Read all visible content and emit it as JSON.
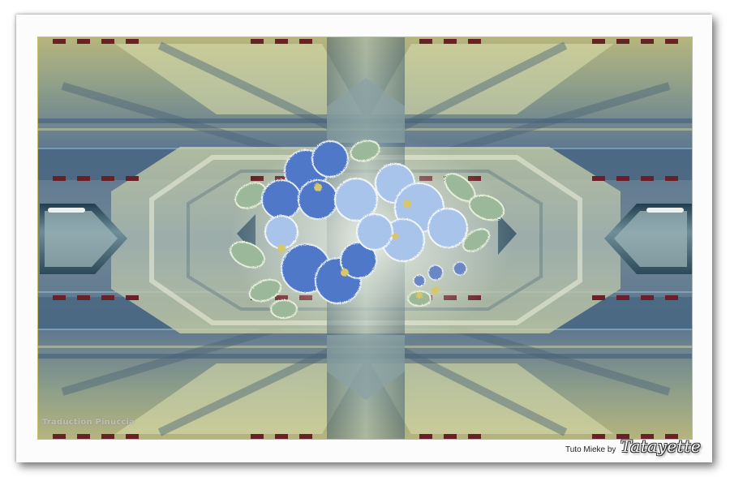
{
  "artwork": {
    "watermark_text": "Traduction Pinuccia",
    "credit_text": "Tuto Mieke by",
    "signature_text": "Tatayette"
  },
  "colors": {
    "frame": "#fcfcfc",
    "art_border": "#c9c06a",
    "olive": "#a8ac74",
    "slate_blue": "#4e6e86",
    "teal_grey": "#7f9694",
    "mauve_marks": "#6a2027",
    "flower_blue": "#4f78c8",
    "flower_leaf": "#9bb99a"
  }
}
